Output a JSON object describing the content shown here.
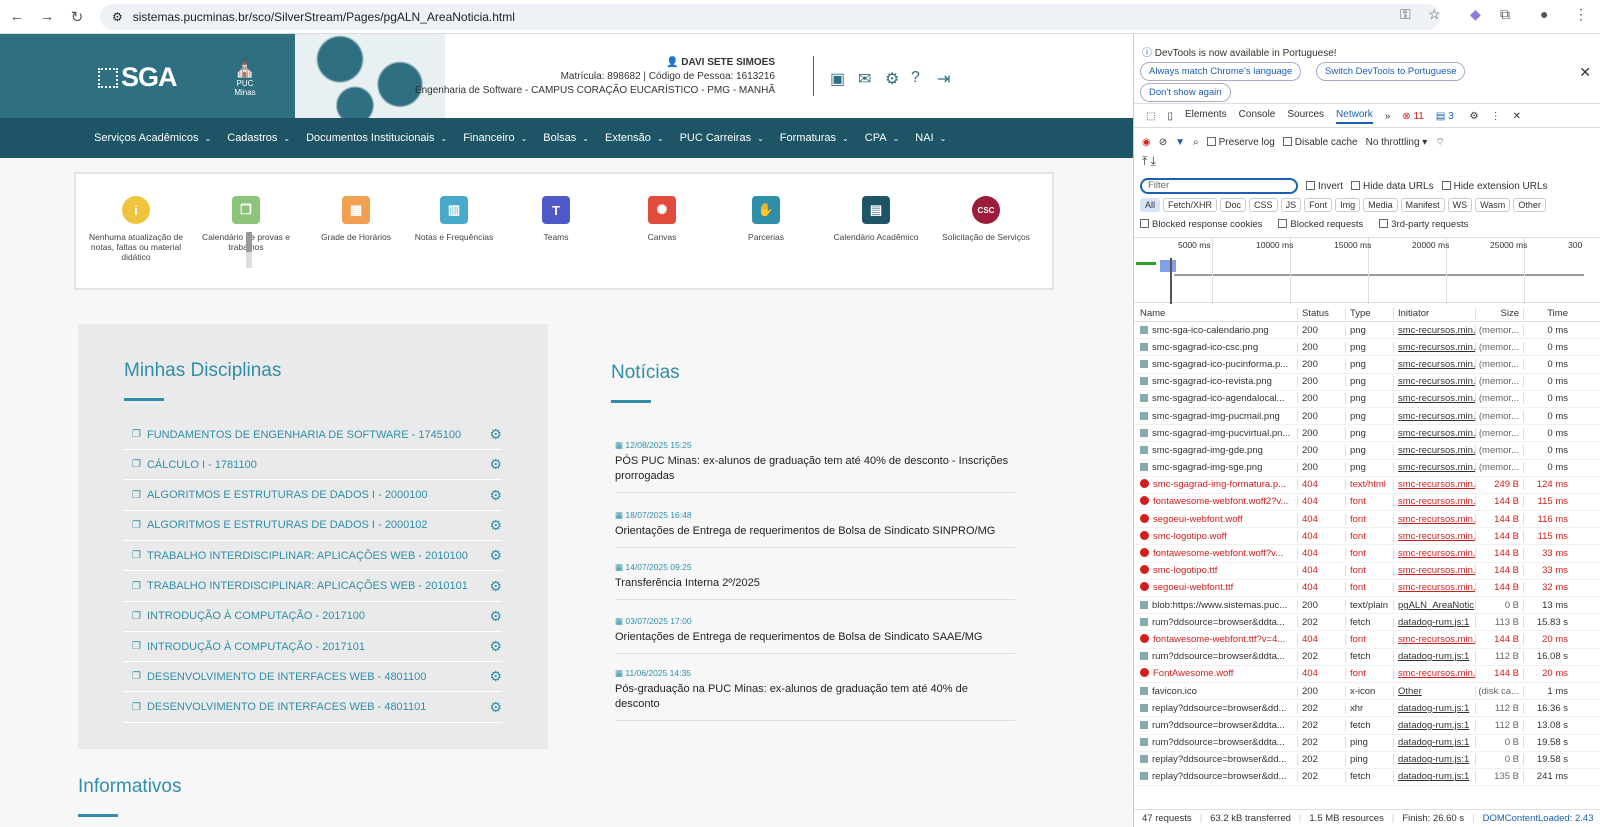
{
  "browser": {
    "url": "sistemas.pucminas.br/sco/SilverStream/Pages/pgALN_AreaNoticia.html"
  },
  "header": {
    "logo": "SGA",
    "puc": "PUC Minas",
    "user_name": "DAVI SETE SIMOES",
    "user_line2": "Matrícula: 898682 | Código de Pessoa: 1613216",
    "user_line3": "Engenharia de Software - CAMPUS CORAÇÃO EUCARÍSTICO - PMG - MANHÃ"
  },
  "menu": [
    "Serviços Acadêmicos",
    "Cadastros",
    "Documentos Institucionais",
    "Financeiro",
    "Bolsas",
    "Extensão",
    "PUC Carreiras",
    "Formaturas",
    "CPA",
    "NAI"
  ],
  "shortcuts": [
    {
      "label": "Nenhuma atualização de notas, faltas ou material didático",
      "color": "#f0c43c",
      "glyph": "i"
    },
    {
      "label": "Calendário de provas e trabalhos",
      "color": "#8cc47a",
      "glyph": "❐"
    },
    {
      "label": "Grade de Horários",
      "color": "#f0a050",
      "glyph": "▦"
    },
    {
      "label": "Notas e Frequências",
      "color": "#49a9c9",
      "glyph": "▥"
    },
    {
      "label": "Teams",
      "color": "#5059c9",
      "glyph": "T"
    },
    {
      "label": "Canvas",
      "color": "#e14b3c",
      "glyph": "✺"
    },
    {
      "label": "Parcerias",
      "color": "#2f8fa9",
      "glyph": "✋"
    },
    {
      "label": "Calendário Acadêmico",
      "color": "#1d5566",
      "glyph": "▤"
    },
    {
      "label": "Solicitação de Serviços",
      "color": "#9c1d3a",
      "glyph": "CSC"
    }
  ],
  "disciplinas": {
    "title": "Minhas Disciplinas",
    "items": [
      "FUNDAMENTOS DE ENGENHARIA DE SOFTWARE - 1745100",
      "CÁLCULO I - 1781100",
      "ALGORITMOS E ESTRUTURAS DE DADOS I - 2000100",
      "ALGORITMOS E ESTRUTURAS DE DADOS I - 2000102",
      "TRABALHO INTERDISCIPLINAR: APLICAÇÕES WEB - 2010100",
      "TRABALHO INTERDISCIPLINAR: APLICAÇÕES WEB - 2010101",
      "INTRODUÇÃO À COMPUTAÇÃO - 2017100",
      "INTRODUÇÃO À COMPUTAÇÃO - 2017101",
      "DESENVOLVIMENTO DE INTERFACES WEB - 4801100",
      "DESENVOLVIMENTO DE INTERFACES WEB - 4801101"
    ]
  },
  "noticias": {
    "title": "Notícias",
    "items": [
      {
        "date": "12/08/2025 15:25",
        "text": "PÓS PUC Minas: ex-alunos de graduação tem até 40% de desconto - Inscrições prorrogadas"
      },
      {
        "date": "18/07/2025 16:48",
        "text": "Orientações de Entrega de requerimentos de Bolsa de Sindicato SINPRO/MG"
      },
      {
        "date": "14/07/2025 09:25",
        "text": "Transferência Interna 2º/2025"
      },
      {
        "date": "03/07/2025 17:00",
        "text": "Orientações de Entrega de requerimentos de Bolsa de Sindicato SAAE/MG"
      },
      {
        "date": "11/06/2025 14:35",
        "text": "Pós-graduação na PUC Minas: ex-alunos de graduação tem até 40% de desconto"
      }
    ]
  },
  "informativos": "Informativos",
  "devtools": {
    "banner": "DevTools is now available in Portuguese!",
    "btn1": "Always match Chrome's language",
    "btn2": "Switch DevTools to Portuguese",
    "btn3": "Don't show again",
    "tabs": [
      "Elements",
      "Console",
      "Sources",
      "Network"
    ],
    "err_count": "11",
    "msg_count": "3",
    "preserve": "Preserve log",
    "disable_cache": "Disable cache",
    "throttle": "No throttling",
    "filter": "Filter",
    "invert": "Invert",
    "hide_data": "Hide data URLs",
    "hide_ext": "Hide extension URLs",
    "types": [
      "All",
      "Fetch/XHR",
      "Doc",
      "CSS",
      "JS",
      "Font",
      "Img",
      "Media",
      "Manifest",
      "WS",
      "Wasm",
      "Other"
    ],
    "blocked_cookies": "Blocked response cookies",
    "blocked_req": "Blocked requests",
    "third_party": "3rd-party requests",
    "ticks": [
      "5000 ms",
      "10000 ms",
      "15000 ms",
      "20000 ms",
      "25000 ms",
      "300"
    ],
    "cols": [
      "Name",
      "Status",
      "Type",
      "Initiator",
      "Size",
      "Time"
    ],
    "rows": [
      {
        "n": "smc-sga-ico-calendario.png",
        "s": "200",
        "t": "png",
        "i": "smc-recursos.min.",
        "z": "(memor...",
        "tm": "0 ms",
        "e": false
      },
      {
        "n": "smc-sgagrad-ico-csc.png",
        "s": "200",
        "t": "png",
        "i": "smc-recursos.min.",
        "z": "(memor...",
        "tm": "0 ms",
        "e": false
      },
      {
        "n": "smc-sgagrad-ico-pucinforma.p...",
        "s": "200",
        "t": "png",
        "i": "smc-recursos.min.",
        "z": "(memor...",
        "tm": "0 ms",
        "e": false
      },
      {
        "n": "smc-sgagrad-ico-revista.png",
        "s": "200",
        "t": "png",
        "i": "smc-recursos.min.",
        "z": "(memor...",
        "tm": "0 ms",
        "e": false
      },
      {
        "n": "smc-sgagrad-ico-agendalocal...",
        "s": "200",
        "t": "png",
        "i": "smc-recursos.min.",
        "z": "(memor...",
        "tm": "0 ms",
        "e": false
      },
      {
        "n": "smc-sgagrad-img-pucmail.png",
        "s": "200",
        "t": "png",
        "i": "smc-recursos.min.",
        "z": "(memor...",
        "tm": "0 ms",
        "e": false
      },
      {
        "n": "smc-sgagrad-img-pucvirtual.pn...",
        "s": "200",
        "t": "png",
        "i": "smc-recursos.min.",
        "z": "(memor...",
        "tm": "0 ms",
        "e": false
      },
      {
        "n": "smc-sgagrad-img-gde.png",
        "s": "200",
        "t": "png",
        "i": "smc-recursos.min.",
        "z": "(memor...",
        "tm": "0 ms",
        "e": false
      },
      {
        "n": "smc-sgagrad-img-sge.png",
        "s": "200",
        "t": "png",
        "i": "smc-recursos.min.",
        "z": "(memor...",
        "tm": "0 ms",
        "e": false
      },
      {
        "n": "smc-sgagrad-img-formatura.p...",
        "s": "404",
        "t": "text/html",
        "i": "smc-recursos.min.",
        "z": "249 B",
        "tm": "124 ms",
        "e": true
      },
      {
        "n": "fontawesome-webfont.woff2?v...",
        "s": "404",
        "t": "font",
        "i": "smc-recursos.min.",
        "z": "144 B",
        "tm": "115 ms",
        "e": true
      },
      {
        "n": "segoeui-webfont.woff",
        "s": "404",
        "t": "font",
        "i": "smc-recursos.min.",
        "z": "144 B",
        "tm": "116 ms",
        "e": true
      },
      {
        "n": "smc-logotipo.woff",
        "s": "404",
        "t": "font",
        "i": "smc-recursos.min.",
        "z": "144 B",
        "tm": "115 ms",
        "e": true
      },
      {
        "n": "fontawesome-webfont.woff?v...",
        "s": "404",
        "t": "font",
        "i": "smc-recursos.min.",
        "z": "144 B",
        "tm": "33 ms",
        "e": true
      },
      {
        "n": "smc-logotipo.ttf",
        "s": "404",
        "t": "font",
        "i": "smc-recursos.min.",
        "z": "144 B",
        "tm": "33 ms",
        "e": true
      },
      {
        "n": "segoeui-webfont.ttf",
        "s": "404",
        "t": "font",
        "i": "smc-recursos.min.",
        "z": "144 B",
        "tm": "32 ms",
        "e": true
      },
      {
        "n": "blob:https://www.sistemas.puc...",
        "s": "200",
        "t": "text/plain",
        "i": "pgALN_AreaNotic",
        "z": "0 B",
        "tm": "13 ms",
        "e": false
      },
      {
        "n": "rum?ddsource=browser&ddta...",
        "s": "202",
        "t": "fetch",
        "i": "datadog-rum.js:1",
        "z": "113 B",
        "tm": "15.83 s",
        "e": false
      },
      {
        "n": "fontawesome-webfont.ttf?v=4...",
        "s": "404",
        "t": "font",
        "i": "smc-recursos.min.",
        "z": "144 B",
        "tm": "20 ms",
        "e": true
      },
      {
        "n": "rum?ddsource=browser&ddta...",
        "s": "202",
        "t": "fetch",
        "i": "datadog-rum.js:1",
        "z": "112 B",
        "tm": "16.08 s",
        "e": false
      },
      {
        "n": "FontAwesome.woff",
        "s": "404",
        "t": "font",
        "i": "smc-recursos.min.",
        "z": "144 B",
        "tm": "20 ms",
        "e": true
      },
      {
        "n": "favicon.ico",
        "s": "200",
        "t": "x-icon",
        "i": "Other",
        "z": "(disk ca...",
        "tm": "1 ms",
        "e": false
      },
      {
        "n": "replay?ddsource=browser&dd...",
        "s": "202",
        "t": "xhr",
        "i": "datadog-rum.js:1",
        "z": "112 B",
        "tm": "16.36 s",
        "e": false
      },
      {
        "n": "rum?ddsource=browser&ddta...",
        "s": "202",
        "t": "fetch",
        "i": "datadog-rum.js:1",
        "z": "112 B",
        "tm": "13.08 s",
        "e": false
      },
      {
        "n": "rum?ddsource=browser&ddta...",
        "s": "202",
        "t": "ping",
        "i": "datadog-rum.js:1",
        "z": "0 B",
        "tm": "19.58 s",
        "e": false
      },
      {
        "n": "replay?ddsource=browser&dd...",
        "s": "202",
        "t": "ping",
        "i": "datadog-rum.js:1",
        "z": "0 B",
        "tm": "19.58 s",
        "e": false
      },
      {
        "n": "replay?ddsource=browser&dd...",
        "s": "202",
        "t": "fetch",
        "i": "datadog-rum.js:1",
        "z": "135 B",
        "tm": "241 ms",
        "e": false
      }
    ],
    "status": [
      "47 requests",
      "63.2 kB transferred",
      "1.5 MB resources",
      "Finish: 26.60 s",
      "DOMContentLoaded: 2.43"
    ]
  }
}
